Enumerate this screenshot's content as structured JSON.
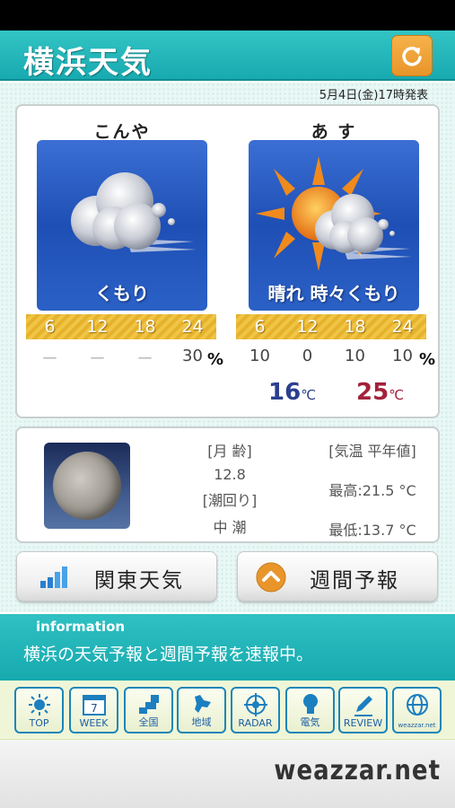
{
  "app": {
    "title": "横浜天気"
  },
  "header": {
    "issued": "5月4日(金)17時発表"
  },
  "forecast": {
    "tonight": {
      "label": "こんや",
      "weather": "くもり",
      "icon": "cloudy-icon",
      "hours": [
        "6",
        "12",
        "18",
        "24"
      ],
      "pop": [
        "ー",
        "ー",
        "ー",
        "30"
      ]
    },
    "tomorrow": {
      "label": "あ す",
      "weather": "晴れ 時々くもり",
      "icon": "sunny-cloudy-icon",
      "hours": [
        "6",
        "12",
        "18",
        "24"
      ],
      "pop": [
        "10",
        "0",
        "10",
        "10"
      ],
      "temp_min": "16",
      "temp_max": "25"
    },
    "pct_unit": "%",
    "temp_unit": "℃"
  },
  "almanac": {
    "moon_age_label": "[月 齢]",
    "moon_age": "12.8",
    "tide_label": "[潮回り]",
    "tide": "中 潮",
    "normal_label": "[気温 平年値]",
    "normal_high": "最高:21.5 °C",
    "normal_low": "最低:13.7 °C"
  },
  "buttons": {
    "kanto": "関東天気",
    "weekly": "週間予報"
  },
  "information": {
    "heading": "information",
    "message": "横浜の天気予報と週間予報を速報中。"
  },
  "tabs": [
    {
      "label": "TOP",
      "icon": "sun-icon"
    },
    {
      "label": "WEEK",
      "icon": "calendar-icon",
      "badge": "7"
    },
    {
      "label": "全国",
      "icon": "japan-map-icon"
    },
    {
      "label": "地域",
      "icon": "hokkaido-map-icon"
    },
    {
      "label": "RADAR",
      "icon": "radar-icon"
    },
    {
      "label": "電気",
      "icon": "lightbulb-icon"
    },
    {
      "label": "REVIEW",
      "icon": "pencil-icon"
    },
    {
      "label": "weazzar.net",
      "icon": "globe-icon"
    }
  ],
  "footer": {
    "brand": "weazzar.net"
  },
  "colors": {
    "teal": "#17aab0",
    "orange": "#e8952a",
    "min_temp": "#2b3f8f",
    "max_temp": "#a3213a"
  }
}
